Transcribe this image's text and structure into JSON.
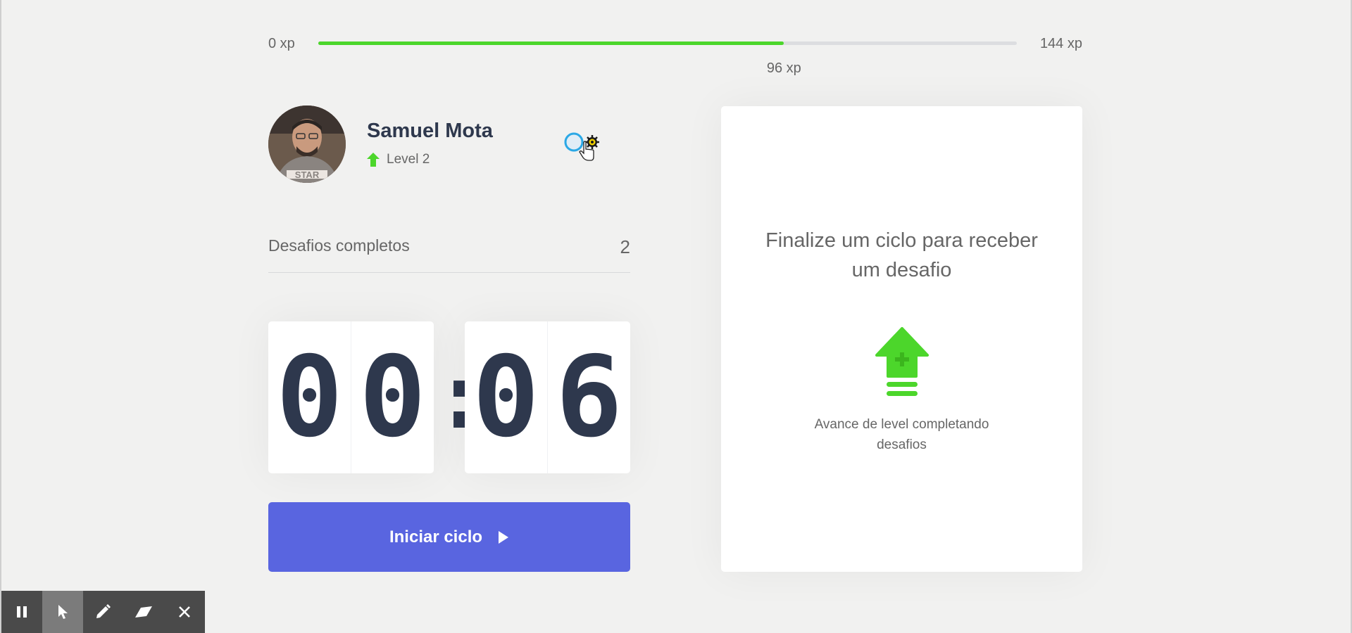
{
  "xp": {
    "min_label": "0 xp",
    "max_label": "144 xp",
    "current_label": "96 xp",
    "current": 96,
    "max": 144
  },
  "profile": {
    "name": "Samuel Mota",
    "level_label": "Level 2"
  },
  "challenges": {
    "label": "Desafios completos",
    "count": "2"
  },
  "countdown": {
    "minute_left": "0",
    "minute_right": "0",
    "separator": ":",
    "second_left": "0",
    "second_right": "6"
  },
  "start_button": {
    "label": "Iniciar ciclo"
  },
  "challenge_box": {
    "title": "Finalize um ciclo para receber um desafio",
    "description": "Avance de level completando desafios"
  },
  "recorder_toolbar": {
    "tools": [
      "pause-icon",
      "pointer-icon",
      "pencil-icon",
      "eraser-icon",
      "close-icon"
    ],
    "active_tool": "pointer-icon"
  },
  "colors": {
    "accent_green": "#4cd62b",
    "button_blue": "#5965e0",
    "title_dark": "#2e384d",
    "text_gray": "#666666",
    "background": "#f1f1f0"
  }
}
